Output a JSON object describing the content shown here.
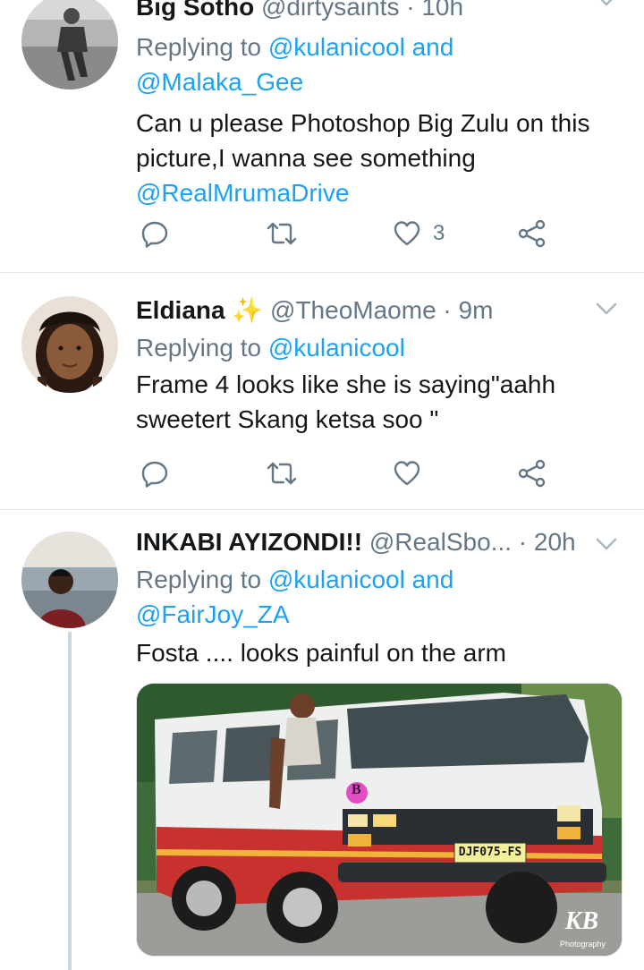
{
  "tweets": [
    {
      "name": "Big Sotho",
      "handle": "@dirtysaints",
      "dot": "·",
      "time": "10h",
      "replying_prefix": "Replying to",
      "replying_to": [
        "@kulanicool",
        "@Malaka_Gee"
      ],
      "replying_and": "and",
      "body_text": "Can u please Photoshop Big Zulu on this picture,I wanna see something",
      "body_mention": "@RealMrumaDrive",
      "like_count": "3",
      "icons": [
        "reply-icon",
        "retweet-icon",
        "heart-icon",
        "share-icon",
        "chevron-down-icon"
      ]
    },
    {
      "name": "Eldiana",
      "emoji": "✨",
      "handle": "@TheoMaome",
      "dot": "·",
      "time": "9m",
      "replying_prefix": "Replying to",
      "replying_to": [
        "@kulanicool"
      ],
      "body_text": "Frame 4 looks like she is saying\"aahh sweetert Skang ketsa soo \"",
      "like_count": "",
      "icons": [
        "reply-icon",
        "retweet-icon",
        "heart-icon",
        "share-icon",
        "chevron-down-icon"
      ]
    },
    {
      "name": "INKABI AYIZONDI!!",
      "handle": "@RealSbo...",
      "dot": "·",
      "time": "20h",
      "replying_prefix": "Replying to",
      "replying_to": [
        "@kulanicool",
        "@FairJoy_ZA"
      ],
      "replying_and": "and",
      "body_text": "Fosta .... looks painful on the arm",
      "media": {
        "plate": "DJF075-FS",
        "badge": "B",
        "watermark": "KB",
        "watermark_sub": "Photography"
      },
      "icons": [
        "chevron-down-icon"
      ]
    }
  ],
  "colors": {
    "accent": "#1da1f2",
    "secondary_text": "#657786",
    "divider": "#e1e8ed",
    "thread_line": "#ccd6dd"
  }
}
